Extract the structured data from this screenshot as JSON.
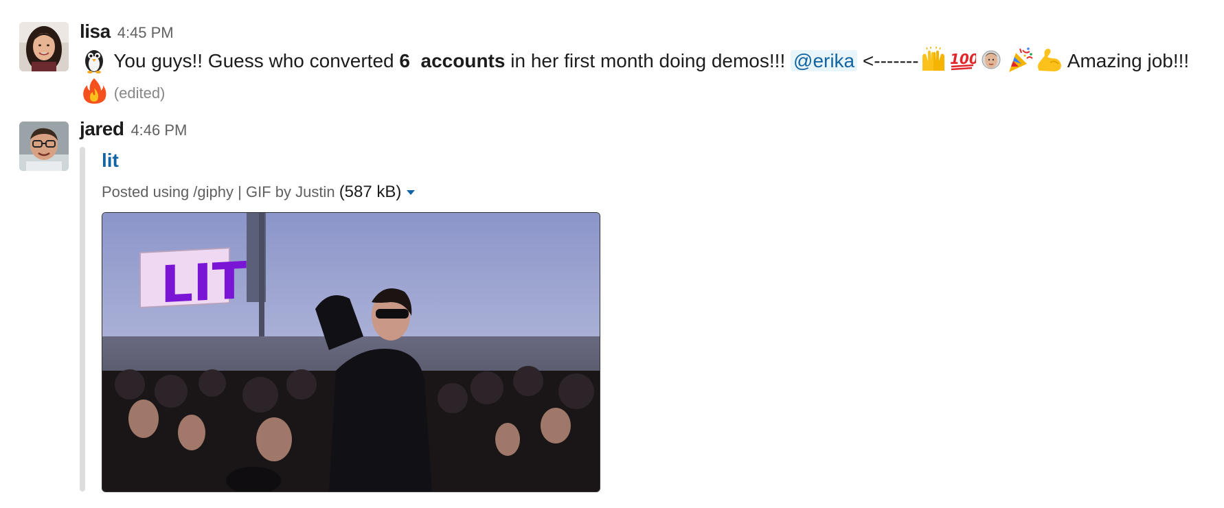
{
  "messages": [
    {
      "username": "lisa",
      "time": "4:45 PM",
      "text": {
        "intro": "You guys!! Guess who converted",
        "count": "6",
        "bold_word": "accounts",
        "rest": "in her first month doing demos!!!",
        "mention": "@erika",
        "arrow": "<-------",
        "closing": "Amazing job!!!",
        "edited": "(edited)"
      },
      "emojis": [
        "penguin-icon",
        "raised-hands-icon",
        "hundred-points-icon",
        "custom-face-icon",
        "party-popper-icon",
        "flexed-biceps-icon",
        "fire-icon"
      ]
    },
    {
      "username": "jared",
      "time": "4:46 PM",
      "attachment": {
        "title": "lit",
        "meta": "Posted using /giphy | GIF by Justin",
        "size": "(587 kB)",
        "gif_text": "LIT"
      }
    }
  ],
  "colors": {
    "link": "#1264a3",
    "mention_bg": "#e8f5fa",
    "attachment_bar": "#dddddd"
  }
}
